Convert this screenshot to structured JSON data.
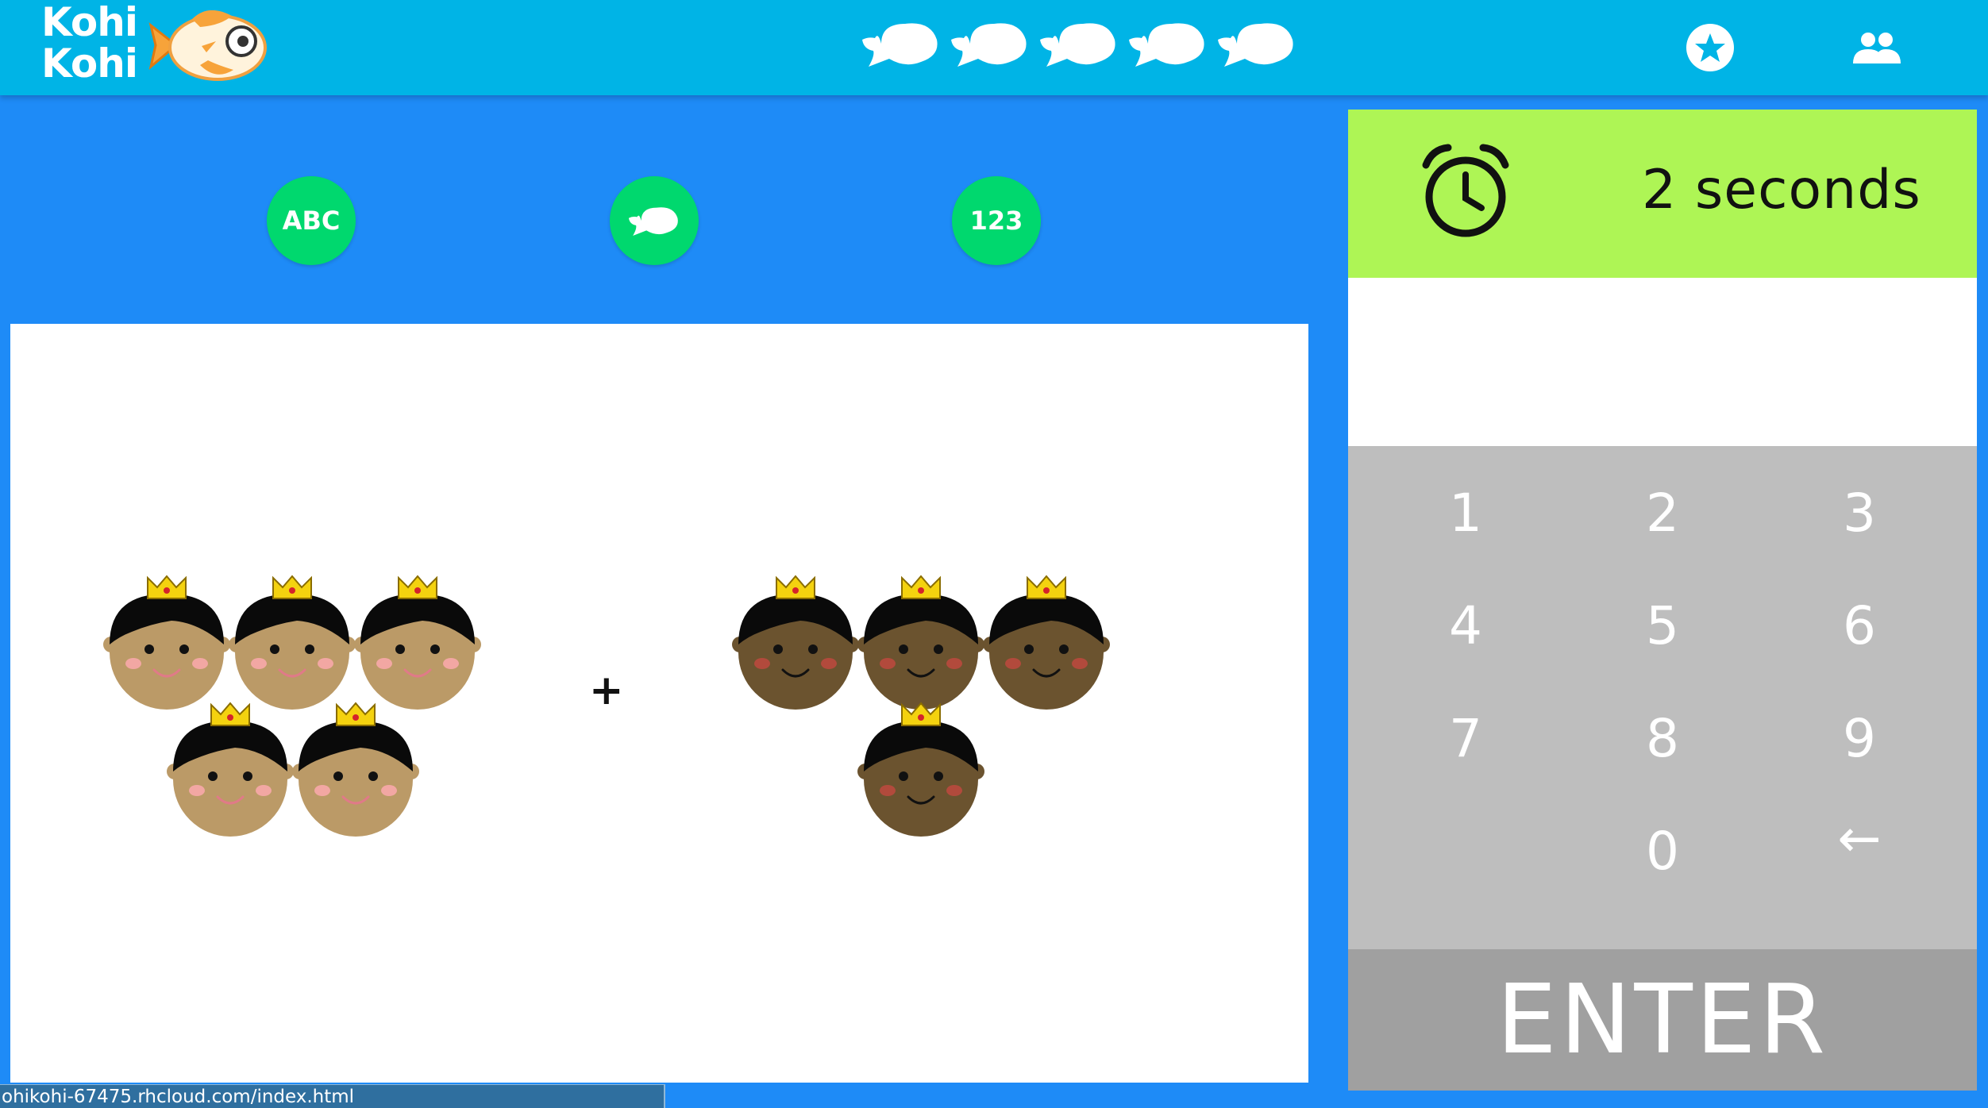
{
  "app": {
    "logo_line1": "Kohi",
    "logo_line2": "Kohi",
    "brand_color": "#00b4e6"
  },
  "header": {
    "lives": {
      "icon": "fish-icon",
      "count": 5
    },
    "buttons": [
      {
        "name": "favorites-button",
        "icon": "star-icon"
      },
      {
        "name": "users-button",
        "icon": "people-icon"
      }
    ]
  },
  "modes": [
    {
      "label": "ABC"
    },
    {
      "label": "",
      "icon": "fish-icon"
    },
    {
      "label": "123"
    }
  ],
  "problem": {
    "operator": "+",
    "left_count": 5,
    "right_count": 4,
    "left_skin": "#bb9a67",
    "right_skin": "#6b532f"
  },
  "timer": {
    "text": "2 seconds",
    "icon": "alarm-clock-icon",
    "bg": "#aef555"
  },
  "answer": {
    "value": ""
  },
  "keypad": {
    "keys": [
      "1",
      "2",
      "3",
      "4",
      "5",
      "6",
      "7",
      "8",
      "9",
      "",
      "0",
      "←"
    ],
    "enter_label": "ENTER"
  },
  "status_bar": {
    "url": "ohikohi-67475.rhcloud.com/index.html"
  }
}
